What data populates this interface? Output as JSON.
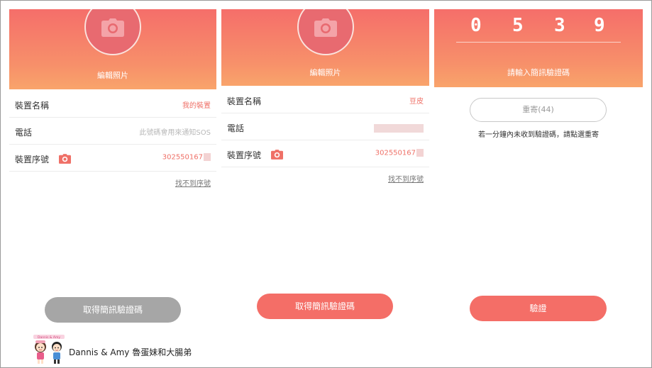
{
  "screen1": {
    "edit_photo": "編輯照片",
    "rows": [
      {
        "label": "裝置名稱",
        "value": "我的裝置"
      },
      {
        "label": "電話",
        "placeholder": "此號碼會用來通知SOS"
      },
      {
        "label": "裝置序號",
        "value": "302550167"
      }
    ],
    "not_found_link": "找不到序號",
    "submit": "取得簡訊驗證碼",
    "submit_state": "disabled"
  },
  "screen2": {
    "edit_photo": "編輯照片",
    "rows": [
      {
        "label": "裝置名稱",
        "value": "豆皮"
      },
      {
        "label": "電話"
      },
      {
        "label": "裝置序號",
        "value": "302550167"
      }
    ],
    "not_found_link": "找不到序號",
    "submit": "取得簡訊驗證碼"
  },
  "screen3": {
    "code_digits": [
      "0",
      "5",
      "3",
      "9"
    ],
    "prompt": "請輸入簡訊驗證碼",
    "resend": "重寄(44)",
    "hint": "若一分鐘內未收到驗證碼，請點選重寄",
    "verify": "驗證"
  },
  "watermark": {
    "text": "Dannis & Amy 魯蛋妹和大腸弟",
    "logo_caption": "Dannis & Amy"
  },
  "colors": {
    "accent": "#f46e67",
    "header_top": "#f56e6a",
    "header_bottom": "#f9a46b",
    "disabled": "#a6a6a6"
  },
  "icons": {
    "avatar": "camera-icon",
    "serial": "camera-icon"
  }
}
